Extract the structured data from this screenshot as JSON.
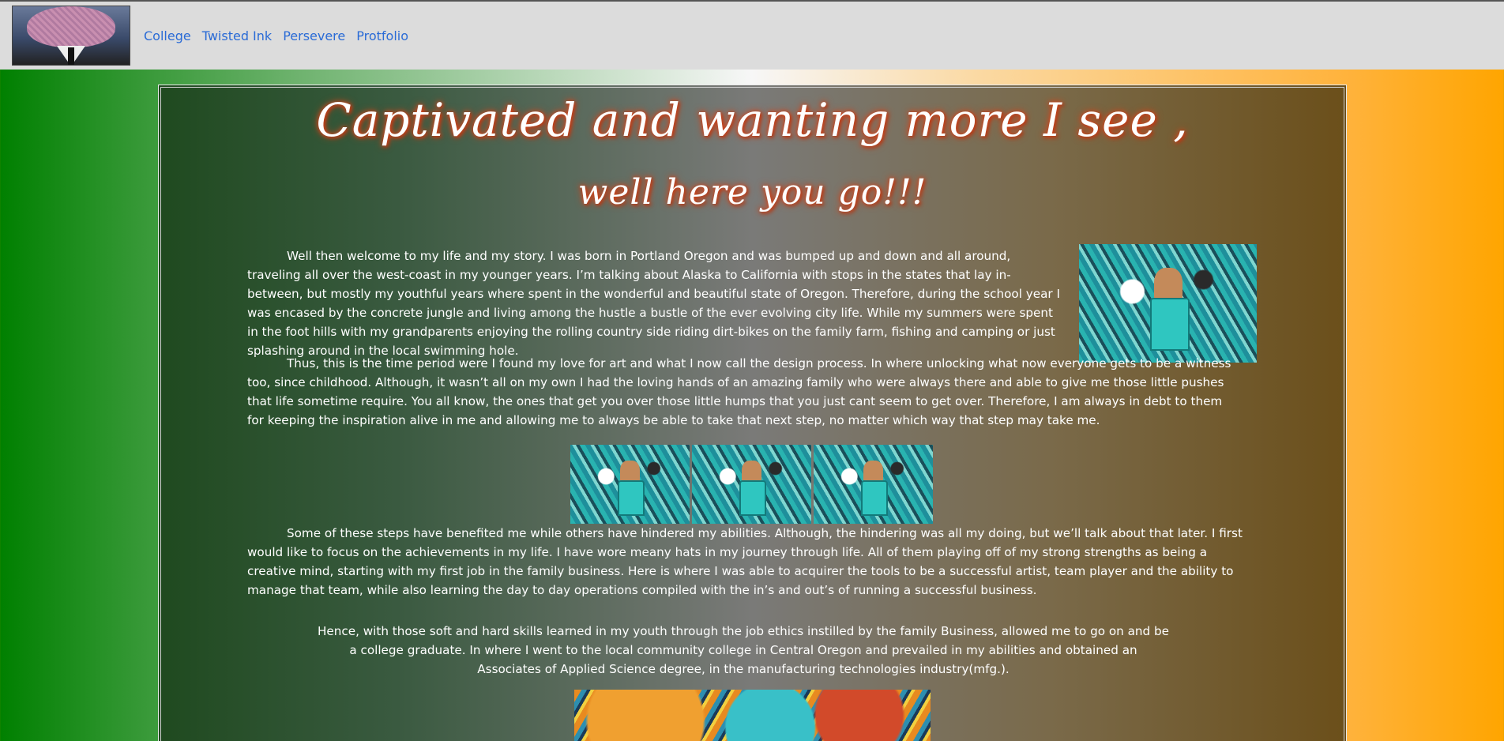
{
  "nav": {
    "logo_label": "site-logo",
    "links": [
      "College",
      "Twisted Ink",
      "Persevere",
      "Protfolio"
    ]
  },
  "main": {
    "title_line1": "Captivated and wanting more I see ,",
    "title_line2": "well here you go!!!",
    "paragraphs": [
      "Well then welcome to my life and my story. I was born in Portland Oregon and was bumped up and down and all around, traveling all over the west-coast in my younger years. I’m talking about Alaska to California with stops in the states that lay in-between, but mostly my youthful years where spent in the wonderful and beautiful state of Oregon. Therefore, during the school year I was encased by the concrete jungle and living among the hustle a bustle of the ever evolving city life. While my summers were spent in the foot hills with my grandparents enjoying the rolling country side riding dirt-bikes on the family farm, fishing and camping or just splashing around in the local swimming hole.",
      "Thus, this is the time period were I found my love for art and what I now call the design process. In where unlocking what now everyone gets to be a witness too, since childhood. Although, it wasn’t all on my own I had the loving hands of an amazing family who were always there and able to give me those little pushes that life sometime require. You all know, the ones that get you over those little humps that you just cant seem to get over. Therefore, I am always in debt to them for keeping the inspiration alive in me and allowing me to always be able to take that next step, no matter which way that step may take me.",
      "Some of these steps have benefited me while others have hindered my abilities. Although, the hindering was all my doing, but we’ll talk about that later. I first would like to focus on the achievements in my life. I have wore meany hats in my journey through life. All of them playing off of my strong strengths as being a creative mind, starting with my first job in the family business. Here is where I was able to acquirer the tools to be a successful artist, team player and the ability to manage that team, while also learning the day to day operations compiled with the in’s and out’s of running a successful business.",
      "Hence, with those soft and hard skills learned in my youth through the job ethics instilled by the family Business, allowed me to go on and be a college graduate. In where I went to the local community college in Central Oregon and prevailed in my abilities and obtained an Associates of Applied Science degree, in the manufacturing technologies industry(mfg.)."
    ]
  },
  "colors": {
    "nav_bg": "#dcdcdc",
    "link": "#2a6bd6",
    "title_glow": "#d2471f",
    "bg_left": "#008000",
    "bg_right": "#ffa500"
  }
}
